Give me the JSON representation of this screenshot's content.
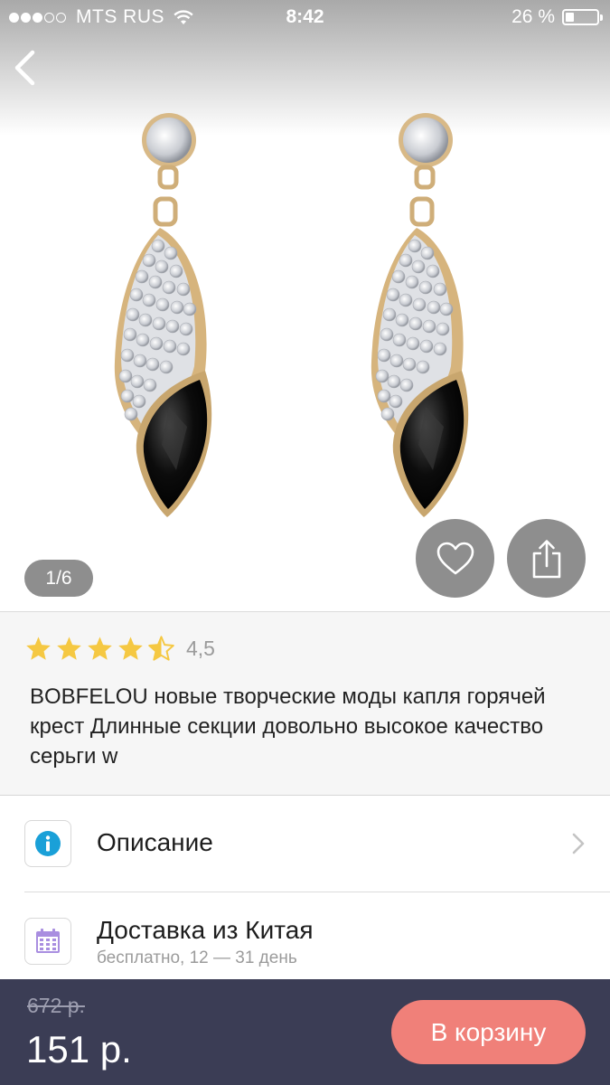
{
  "status_bar": {
    "carrier": "MTS RUS",
    "time": "8:42",
    "battery": "26 %",
    "battery_level": 0.26,
    "signal_bars": 3,
    "signal_total": 5
  },
  "gallery": {
    "page_indicator": "1/6",
    "current_page": 1,
    "total_pages": 6
  },
  "product": {
    "rating": 4.5,
    "rating_text": "4,5",
    "title": "BOBFELOU новые творческие моды капля горячей крест Длинные секции довольно высокое качество серьги w"
  },
  "rows": {
    "description": {
      "title": "Описание",
      "icon": "info-icon"
    },
    "delivery": {
      "title": "Доставка из Китая",
      "subtitle": "бесплатно, 12 — 31 день",
      "icon": "calendar-icon"
    }
  },
  "purchase": {
    "old_price": "672 р.",
    "price": "151 р.",
    "cart_button": "В корзину"
  },
  "colors": {
    "bottom_bar": "#3b3d55",
    "cart_button": "#f08079",
    "star": "#f5c842",
    "info_icon": "#1aa0d8",
    "calendar_icon": "#a98ee0"
  }
}
